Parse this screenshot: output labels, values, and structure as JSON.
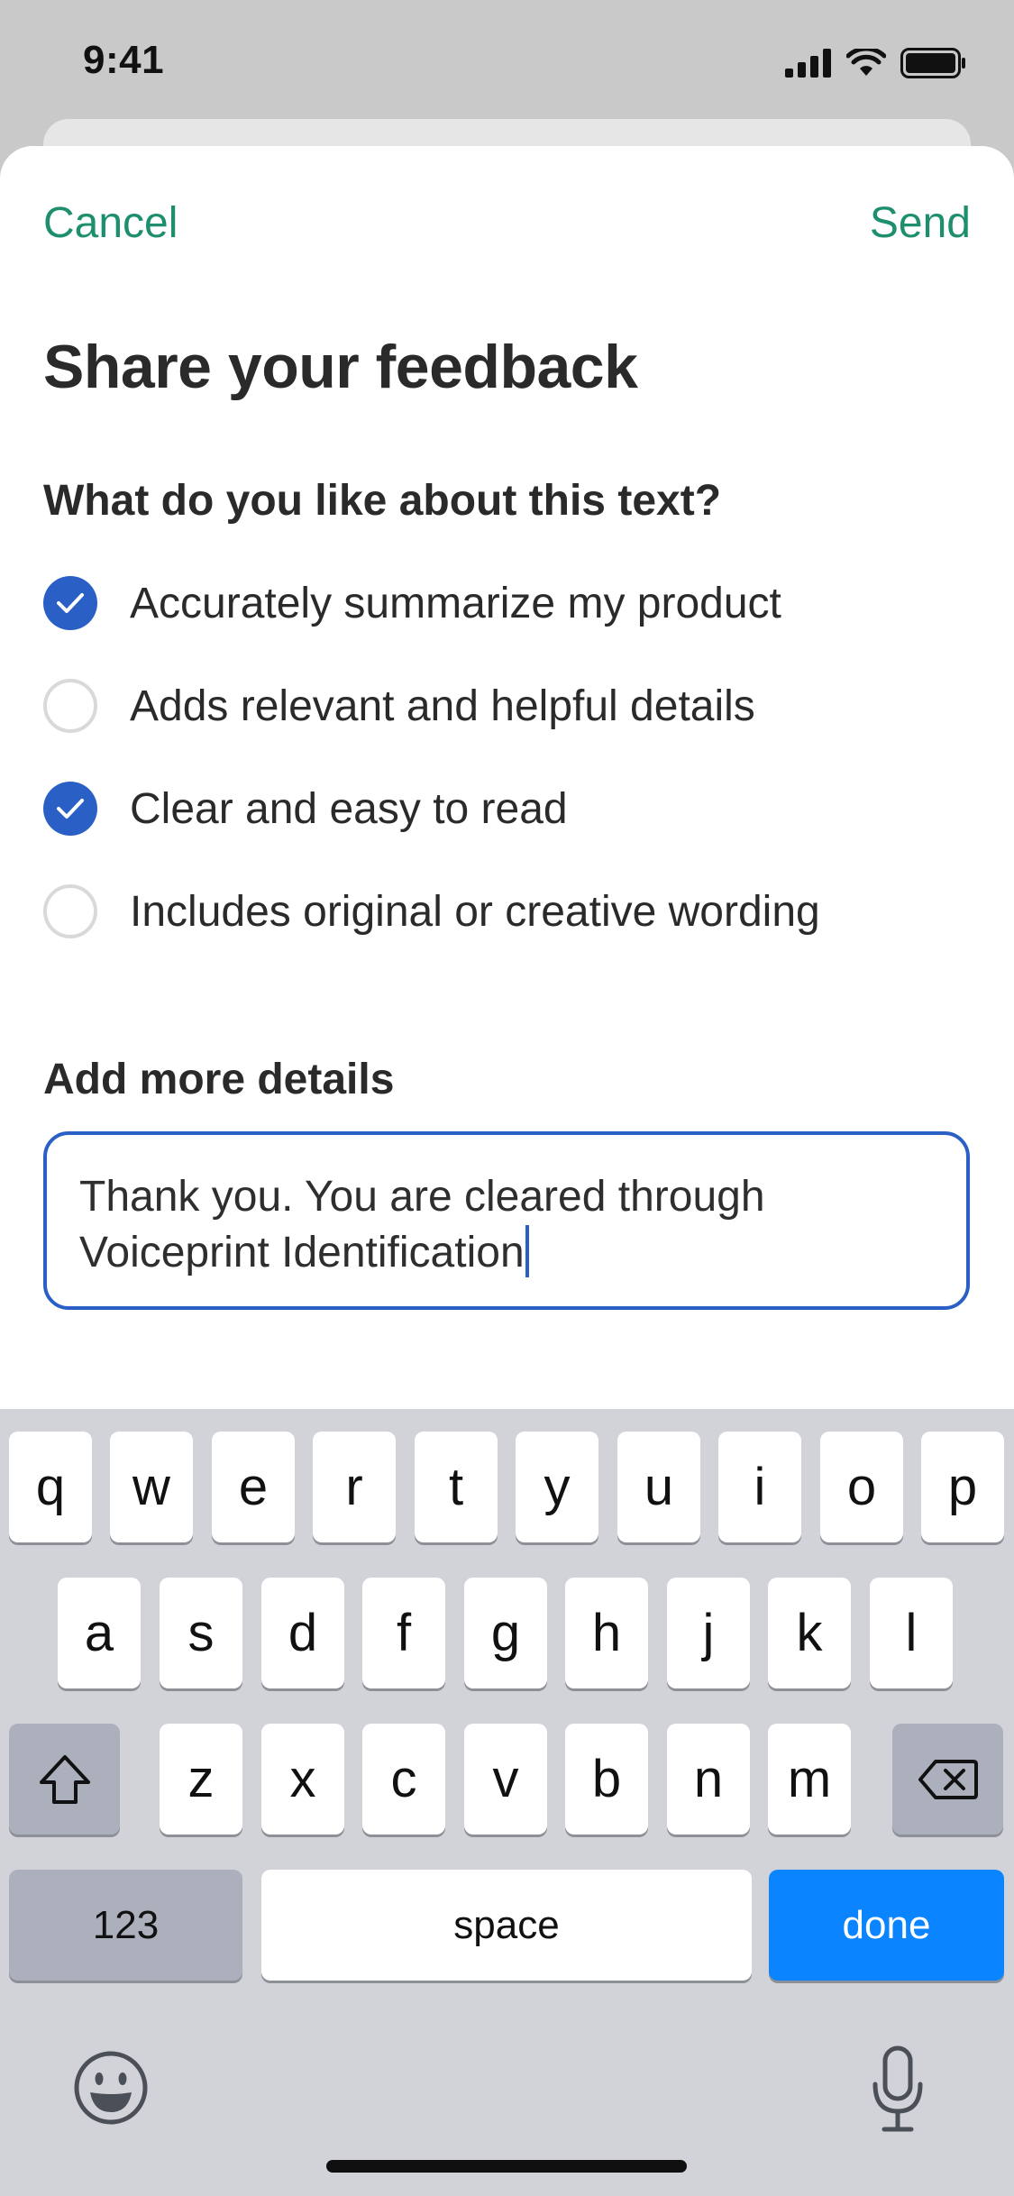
{
  "status": {
    "time": "9:41"
  },
  "nav": {
    "cancel": "Cancel",
    "send": "Send"
  },
  "title": "Share your feedback",
  "question": "What do you like about this text?",
  "options": [
    {
      "label": "Accurately summarize my product",
      "checked": true
    },
    {
      "label": "Adds relevant and helpful details",
      "checked": false
    },
    {
      "label": "Clear and easy to read",
      "checked": true
    },
    {
      "label": "Includes original or creative wording",
      "checked": false
    }
  ],
  "details": {
    "label": "Add more details",
    "line1": "Thank you. You are cleared through",
    "line2": "Voiceprint Identification"
  },
  "keyboard": {
    "row1": [
      "q",
      "w",
      "e",
      "r",
      "t",
      "y",
      "u",
      "i",
      "o",
      "p"
    ],
    "row2": [
      "a",
      "s",
      "d",
      "f",
      "g",
      "h",
      "j",
      "k",
      "l"
    ],
    "row3": [
      "z",
      "x",
      "c",
      "v",
      "b",
      "n",
      "m"
    ],
    "numbers": "123",
    "space": "space",
    "done": "done"
  },
  "colors": {
    "accent_green": "#1d8f6e",
    "check_blue": "#2a60c6",
    "done_blue": "#0a84ff"
  },
  "icons": {
    "status": [
      "cellular-signal-icon",
      "wifi-icon",
      "battery-icon"
    ],
    "keyboard": [
      "shift-icon",
      "delete-icon",
      "emoji-icon",
      "microphone-icon"
    ]
  }
}
